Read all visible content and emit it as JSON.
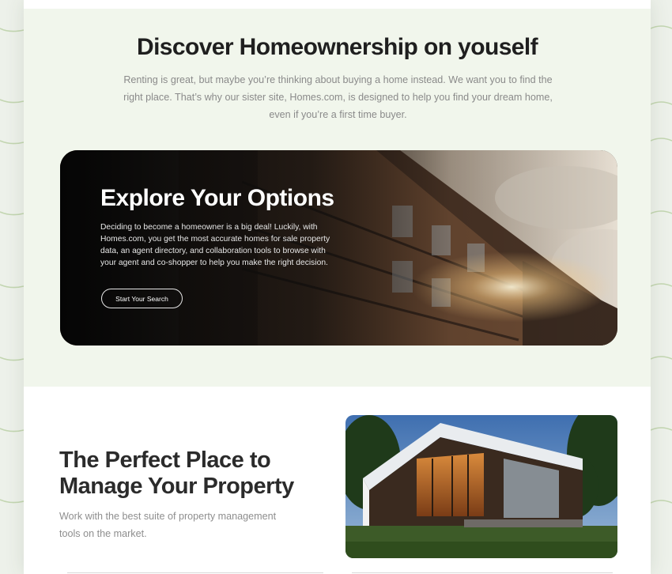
{
  "intro": {
    "title": "Discover Homeownership on youself",
    "text": "Renting is great, but maybe you’re thinking about buying a home instead. We want you to find the right place. That’s why our sister site, Homes.com, is designed to help you find your dream home, even if you’re a first time buyer."
  },
  "hero": {
    "title": "Explore Your Options",
    "text": "Deciding to become a homeowner is a big deal! Luckily, with Homes.com, you get the most accurate homes for sale property data, an agent directory, and collaboration tools to browse with your agent and co-shopper to help you make the right decision.",
    "button_label": "Start Your Search"
  },
  "feature": {
    "title": "The Perfect Place to Manage Your Property",
    "text": "Work with the best suite of property management tools on the market."
  },
  "colors": {
    "page_bg": "#edf1ea",
    "intro_bg": "#f1f6ec",
    "heading": "#1f1f1f",
    "body_text": "#8a8a8a",
    "wave_line": "#b9cfa6"
  }
}
